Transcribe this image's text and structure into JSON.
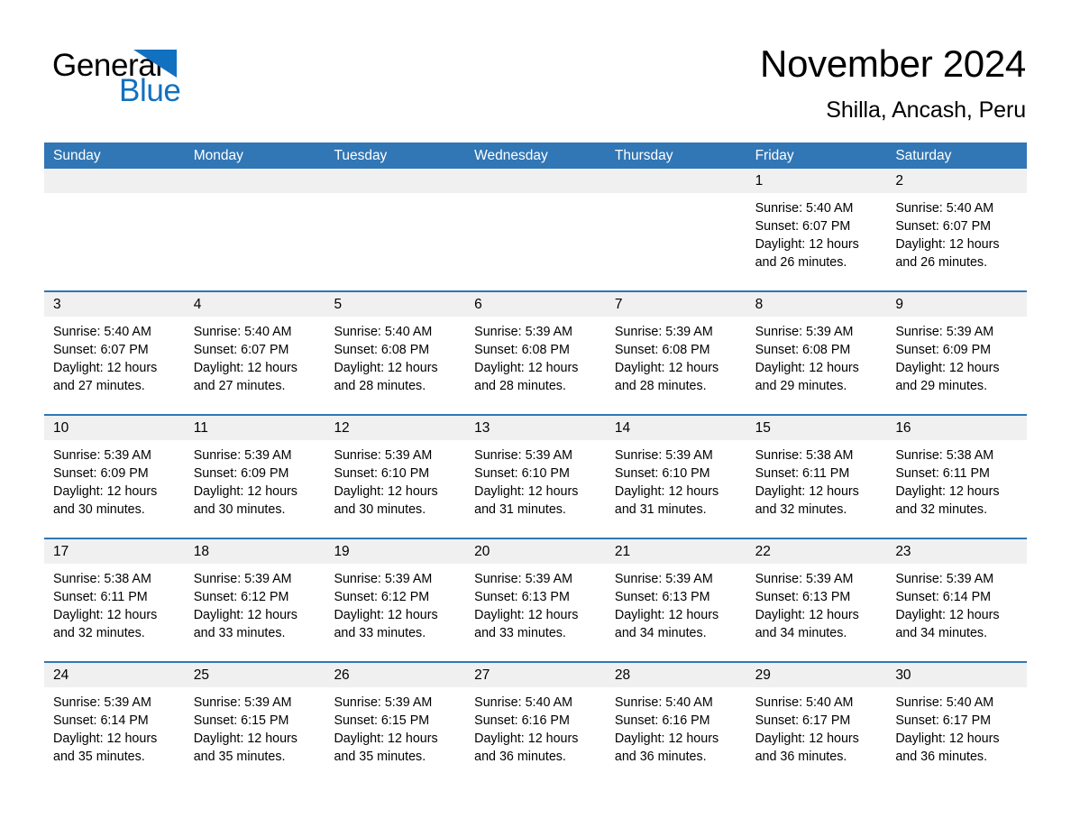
{
  "brand": {
    "name_part1": "General",
    "name_part2": "Blue",
    "accent_color": "#1270c0",
    "triangle_color": "#1270c0"
  },
  "header": {
    "title": "November 2024",
    "location": "Shilla, Ancash, Peru"
  },
  "theme": {
    "header_blue": "#3176b5",
    "daynum_band": "#f0f0f0",
    "text": "#000000"
  },
  "weekdays": [
    "Sunday",
    "Monday",
    "Tuesday",
    "Wednesday",
    "Thursday",
    "Friday",
    "Saturday"
  ],
  "weeks": [
    {
      "days": [
        {
          "num": "",
          "lines": []
        },
        {
          "num": "",
          "lines": []
        },
        {
          "num": "",
          "lines": []
        },
        {
          "num": "",
          "lines": []
        },
        {
          "num": "",
          "lines": []
        },
        {
          "num": "1",
          "lines": [
            "Sunrise: 5:40 AM",
            "Sunset: 6:07 PM",
            "Daylight: 12 hours",
            "and 26 minutes."
          ]
        },
        {
          "num": "2",
          "lines": [
            "Sunrise: 5:40 AM",
            "Sunset: 6:07 PM",
            "Daylight: 12 hours",
            "and 26 minutes."
          ]
        }
      ]
    },
    {
      "days": [
        {
          "num": "3",
          "lines": [
            "Sunrise: 5:40 AM",
            "Sunset: 6:07 PM",
            "Daylight: 12 hours",
            "and 27 minutes."
          ]
        },
        {
          "num": "4",
          "lines": [
            "Sunrise: 5:40 AM",
            "Sunset: 6:07 PM",
            "Daylight: 12 hours",
            "and 27 minutes."
          ]
        },
        {
          "num": "5",
          "lines": [
            "Sunrise: 5:40 AM",
            "Sunset: 6:08 PM",
            "Daylight: 12 hours",
            "and 28 minutes."
          ]
        },
        {
          "num": "6",
          "lines": [
            "Sunrise: 5:39 AM",
            "Sunset: 6:08 PM",
            "Daylight: 12 hours",
            "and 28 minutes."
          ]
        },
        {
          "num": "7",
          "lines": [
            "Sunrise: 5:39 AM",
            "Sunset: 6:08 PM",
            "Daylight: 12 hours",
            "and 28 minutes."
          ]
        },
        {
          "num": "8",
          "lines": [
            "Sunrise: 5:39 AM",
            "Sunset: 6:08 PM",
            "Daylight: 12 hours",
            "and 29 minutes."
          ]
        },
        {
          "num": "9",
          "lines": [
            "Sunrise: 5:39 AM",
            "Sunset: 6:09 PM",
            "Daylight: 12 hours",
            "and 29 minutes."
          ]
        }
      ]
    },
    {
      "days": [
        {
          "num": "10",
          "lines": [
            "Sunrise: 5:39 AM",
            "Sunset: 6:09 PM",
            "Daylight: 12 hours",
            "and 30 minutes."
          ]
        },
        {
          "num": "11",
          "lines": [
            "Sunrise: 5:39 AM",
            "Sunset: 6:09 PM",
            "Daylight: 12 hours",
            "and 30 minutes."
          ]
        },
        {
          "num": "12",
          "lines": [
            "Sunrise: 5:39 AM",
            "Sunset: 6:10 PM",
            "Daylight: 12 hours",
            "and 30 minutes."
          ]
        },
        {
          "num": "13",
          "lines": [
            "Sunrise: 5:39 AM",
            "Sunset: 6:10 PM",
            "Daylight: 12 hours",
            "and 31 minutes."
          ]
        },
        {
          "num": "14",
          "lines": [
            "Sunrise: 5:39 AM",
            "Sunset: 6:10 PM",
            "Daylight: 12 hours",
            "and 31 minutes."
          ]
        },
        {
          "num": "15",
          "lines": [
            "Sunrise: 5:38 AM",
            "Sunset: 6:11 PM",
            "Daylight: 12 hours",
            "and 32 minutes."
          ]
        },
        {
          "num": "16",
          "lines": [
            "Sunrise: 5:38 AM",
            "Sunset: 6:11 PM",
            "Daylight: 12 hours",
            "and 32 minutes."
          ]
        }
      ]
    },
    {
      "days": [
        {
          "num": "17",
          "lines": [
            "Sunrise: 5:38 AM",
            "Sunset: 6:11 PM",
            "Daylight: 12 hours",
            "and 32 minutes."
          ]
        },
        {
          "num": "18",
          "lines": [
            "Sunrise: 5:39 AM",
            "Sunset: 6:12 PM",
            "Daylight: 12 hours",
            "and 33 minutes."
          ]
        },
        {
          "num": "19",
          "lines": [
            "Sunrise: 5:39 AM",
            "Sunset: 6:12 PM",
            "Daylight: 12 hours",
            "and 33 minutes."
          ]
        },
        {
          "num": "20",
          "lines": [
            "Sunrise: 5:39 AM",
            "Sunset: 6:13 PM",
            "Daylight: 12 hours",
            "and 33 minutes."
          ]
        },
        {
          "num": "21",
          "lines": [
            "Sunrise: 5:39 AM",
            "Sunset: 6:13 PM",
            "Daylight: 12 hours",
            "and 34 minutes."
          ]
        },
        {
          "num": "22",
          "lines": [
            "Sunrise: 5:39 AM",
            "Sunset: 6:13 PM",
            "Daylight: 12 hours",
            "and 34 minutes."
          ]
        },
        {
          "num": "23",
          "lines": [
            "Sunrise: 5:39 AM",
            "Sunset: 6:14 PM",
            "Daylight: 12 hours",
            "and 34 minutes."
          ]
        }
      ]
    },
    {
      "days": [
        {
          "num": "24",
          "lines": [
            "Sunrise: 5:39 AM",
            "Sunset: 6:14 PM",
            "Daylight: 12 hours",
            "and 35 minutes."
          ]
        },
        {
          "num": "25",
          "lines": [
            "Sunrise: 5:39 AM",
            "Sunset: 6:15 PM",
            "Daylight: 12 hours",
            "and 35 minutes."
          ]
        },
        {
          "num": "26",
          "lines": [
            "Sunrise: 5:39 AM",
            "Sunset: 6:15 PM",
            "Daylight: 12 hours",
            "and 35 minutes."
          ]
        },
        {
          "num": "27",
          "lines": [
            "Sunrise: 5:40 AM",
            "Sunset: 6:16 PM",
            "Daylight: 12 hours",
            "and 36 minutes."
          ]
        },
        {
          "num": "28",
          "lines": [
            "Sunrise: 5:40 AM",
            "Sunset: 6:16 PM",
            "Daylight: 12 hours",
            "and 36 minutes."
          ]
        },
        {
          "num": "29",
          "lines": [
            "Sunrise: 5:40 AM",
            "Sunset: 6:17 PM",
            "Daylight: 12 hours",
            "and 36 minutes."
          ]
        },
        {
          "num": "30",
          "lines": [
            "Sunrise: 5:40 AM",
            "Sunset: 6:17 PM",
            "Daylight: 12 hours",
            "and 36 minutes."
          ]
        }
      ]
    }
  ]
}
